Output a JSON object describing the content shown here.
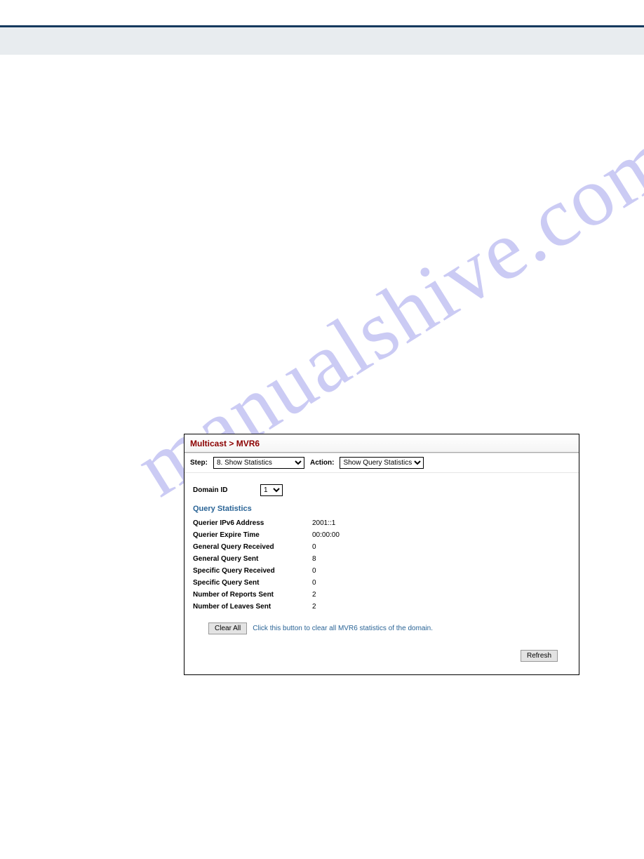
{
  "watermark_text": "manualshive.com",
  "breadcrumb": {
    "part1": "Multicast",
    "sep": " > ",
    "part2": "MVR6"
  },
  "toprow": {
    "step_label": "Step:",
    "step_value": "8. Show Statistics",
    "action_label": "Action:",
    "action_value": "Show Query Statistics"
  },
  "domain": {
    "label": "Domain ID",
    "value": "1"
  },
  "section_title": "Query Statistics",
  "stats": [
    {
      "k": "Querier IPv6 Address",
      "v": "2001::1"
    },
    {
      "k": "Querier Expire Time",
      "v": "00:00:00"
    },
    {
      "k": "General Query Received",
      "v": "0"
    },
    {
      "k": "General Query Sent",
      "v": "8"
    },
    {
      "k": "Specific Query Received",
      "v": "0"
    },
    {
      "k": "Specific Query Sent",
      "v": "0"
    },
    {
      "k": "Number of Reports Sent",
      "v": "2"
    },
    {
      "k": "Number of Leaves Sent",
      "v": "2"
    }
  ],
  "clearall": {
    "button": "Clear All",
    "hint": "Click this button to clear all MVR6 statistics of the domain."
  },
  "refresh_label": "Refresh"
}
